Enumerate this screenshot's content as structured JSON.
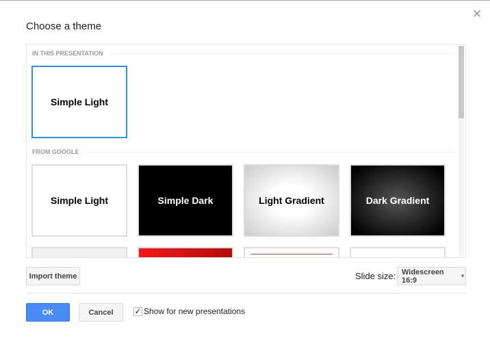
{
  "dialog": {
    "title": "Choose a theme",
    "close_icon": "close-icon"
  },
  "sections": {
    "current": "IN THIS PRESENTATION",
    "google": "FROM GOOGLE"
  },
  "current_theme": {
    "label": "Simple Light"
  },
  "google_themes": [
    {
      "label": "Simple Light"
    },
    {
      "label": "Simple Dark"
    },
    {
      "label": "Light Gradient"
    },
    {
      "label": "Dark Gradient"
    },
    {
      "label": ""
    },
    {
      "label": ""
    },
    {
      "label": ""
    },
    {
      "label": ""
    }
  ],
  "import_label": "Import theme",
  "slide_size": {
    "label": "Slide size:",
    "value": "Widescreen 16:9"
  },
  "ok_label": "OK",
  "cancel_label": "Cancel",
  "show_checkbox": {
    "label": "Show for new presentations",
    "checked": true
  },
  "colors": {
    "accent": "#4a8af4",
    "selected": "#2a90e8"
  }
}
